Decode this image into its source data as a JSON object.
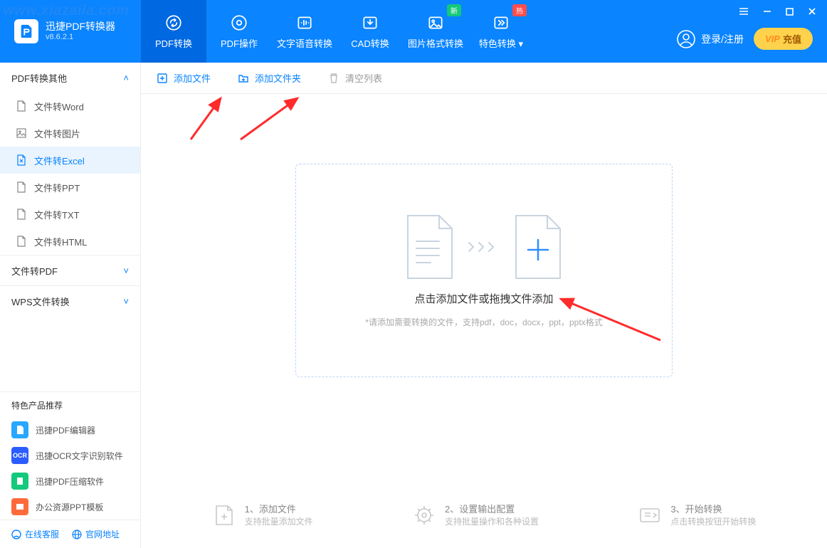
{
  "watermark": "www.xiazaila.com",
  "app": {
    "name": "迅捷PDF转换器",
    "version": "v8.6.2.1"
  },
  "topnav": [
    {
      "label": "PDF转换",
      "active": true
    },
    {
      "label": "PDF操作"
    },
    {
      "label": "文字语音转换"
    },
    {
      "label": "CAD转换"
    },
    {
      "label": "图片格式转换",
      "badge": "新",
      "badge_kind": "new"
    },
    {
      "label": "特色转换",
      "badge": "热",
      "badge_kind": "hot",
      "dropdown": true
    }
  ],
  "login_text": "登录/注册",
  "vip": {
    "prefix": "VIP",
    "label": "充值"
  },
  "sidebar": {
    "group1_header": "PDF转换其他",
    "group1_items": [
      {
        "label": "文件转Word"
      },
      {
        "label": "文件转图片"
      },
      {
        "label": "文件转Excel",
        "active": true
      },
      {
        "label": "文件转PPT"
      },
      {
        "label": "文件转TXT"
      },
      {
        "label": "文件转HTML"
      }
    ],
    "group2_header": "文件转PDF",
    "group3_header": "WPS文件转换",
    "promo_header": "特色产品推荐",
    "promos": [
      {
        "label": "迅捷PDF编辑器",
        "color": "#29a7ff"
      },
      {
        "label": "迅捷OCR文字识别软件",
        "color": "#2b5cff"
      },
      {
        "label": "迅捷PDF压缩软件",
        "color": "#13c97c"
      },
      {
        "label": "办公资源PPT模板",
        "color": "#ff6a3d"
      }
    ],
    "footer": {
      "support": "在线客服",
      "site": "官网地址"
    }
  },
  "toolbar": {
    "add_file": "添加文件",
    "add_folder": "添加文件夹",
    "clear": "清空列表"
  },
  "dropzone": {
    "title": "点击添加文件或拖拽文件添加",
    "hint": "*请添加需要转换的文件，支持pdf，doc，docx，ppt，pptx格式"
  },
  "steps": [
    {
      "title": "1、添加文件",
      "sub": "支持批量添加文件"
    },
    {
      "title": "2、设置输出配置",
      "sub": "支持批量操作和各种设置"
    },
    {
      "title": "3、开始转换",
      "sub": "点击转换按钮开始转换"
    }
  ]
}
